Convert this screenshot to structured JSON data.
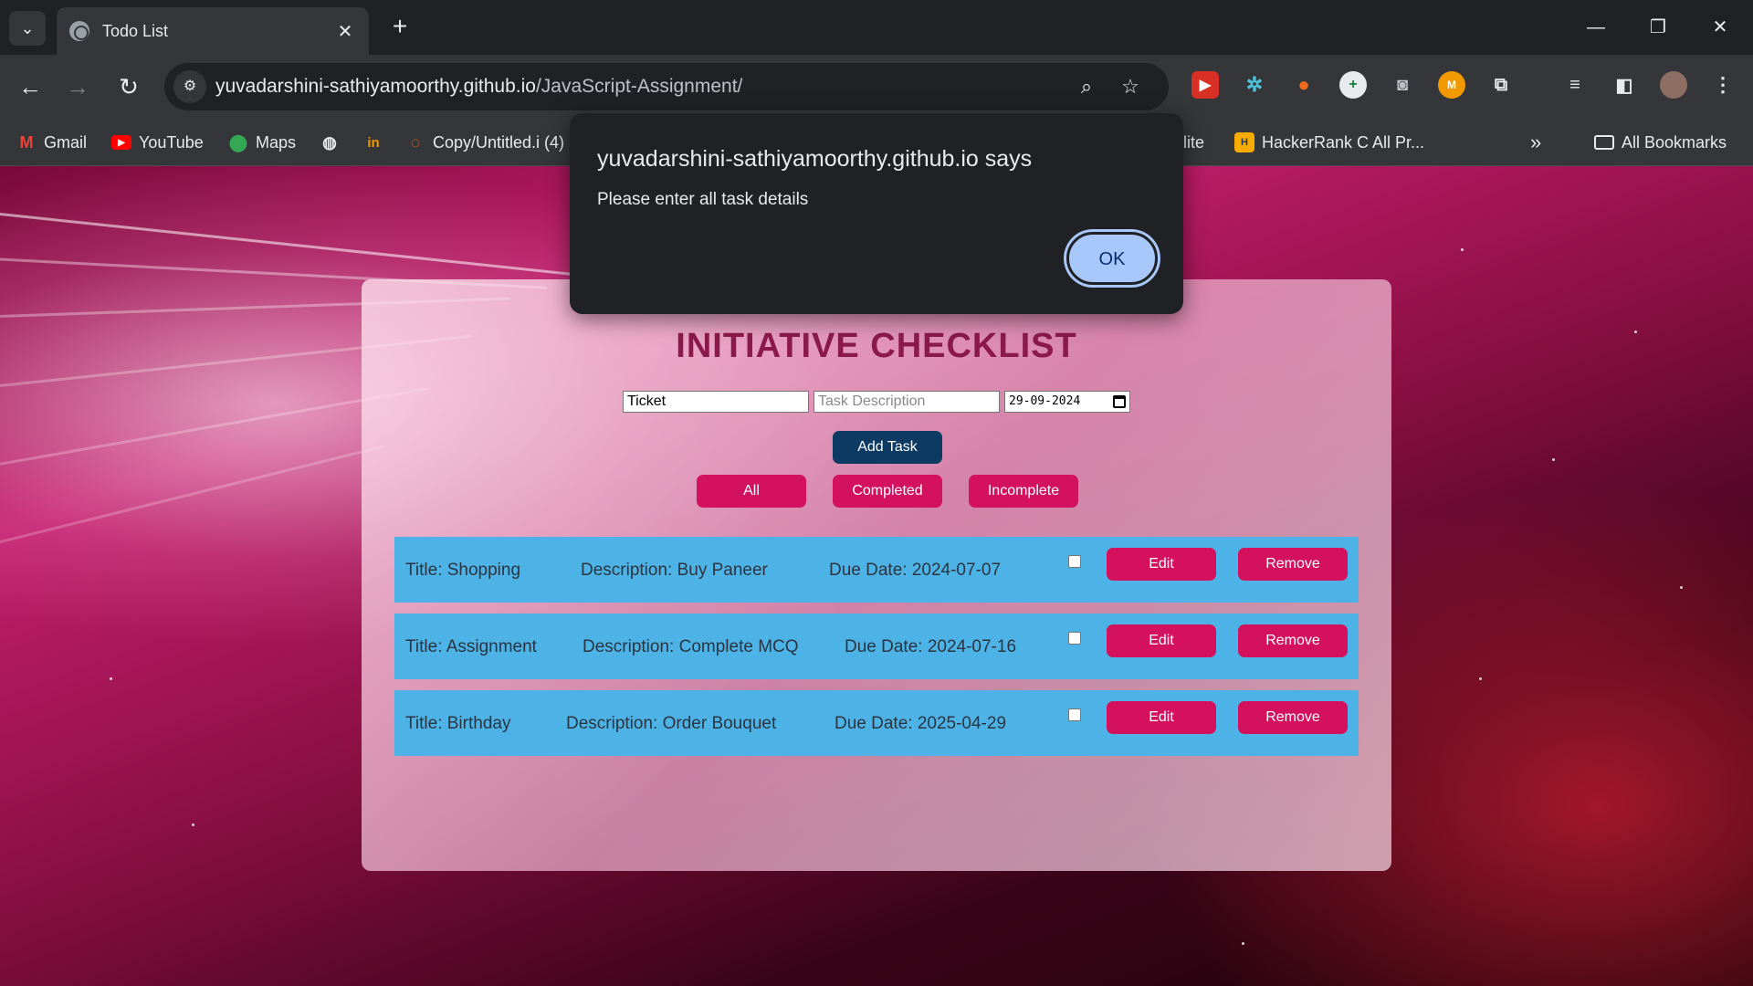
{
  "browser": {
    "tab_title": "Todo List",
    "url_domain": "yuvadarshini-sathiyamoorthy.github.io",
    "url_path": "/JavaScript-Assignment/",
    "all_bookmarks_label": "All Bookmarks",
    "bookmarks": [
      {
        "label": "Gmail",
        "icon": "gmail-icon"
      },
      {
        "label": "YouTube",
        "icon": "youtube-icon"
      },
      {
        "label": "Maps",
        "icon": "maps-icon"
      },
      {
        "label": "",
        "icon": "globe-icon"
      },
      {
        "label": "",
        "icon": "invision-icon"
      },
      {
        "label": "Copy/Untitled.i (4)",
        "icon": "loader-icon"
      },
      {
        "label": "llite",
        "icon": ""
      },
      {
        "label": "HackerRank C All Pr...",
        "icon": "hackerrank-icon"
      }
    ]
  },
  "app": {
    "title": "INITIATIVE CHECKLIST",
    "inputs": {
      "title_value": "Ticket",
      "description_placeholder": "Task Description",
      "date_value": "29-09-2024"
    },
    "add_button": "Add Task",
    "filters": [
      "All",
      "Completed",
      "Incomplete"
    ],
    "tasks": [
      {
        "title": "Title: Shopping",
        "description": "Description: Buy Paneer",
        "due": "Due Date: 2024-07-07",
        "completed": false
      },
      {
        "title": "Title: Assignment",
        "description": "Description: Complete MCQ",
        "due": "Due Date: 2024-07-16",
        "completed": false
      },
      {
        "title": "Title: Birthday",
        "description": "Description: Order Bouquet",
        "due": "Due Date: 2025-04-29",
        "completed": false
      }
    ],
    "edit_label": "Edit",
    "remove_label": "Remove"
  },
  "dialog": {
    "title": "yuvadarshini-sathiyamoorthy.github.io says",
    "message": "Please enter all task details",
    "ok_label": "OK"
  },
  "colors": {
    "accent_pink": "#d3115f",
    "add_button_navy": "#0c3a63",
    "task_row_blue": "#4db3e6",
    "title_maroon": "#8b1a4a",
    "dialog_ok_blue": "#a8c7fa"
  }
}
